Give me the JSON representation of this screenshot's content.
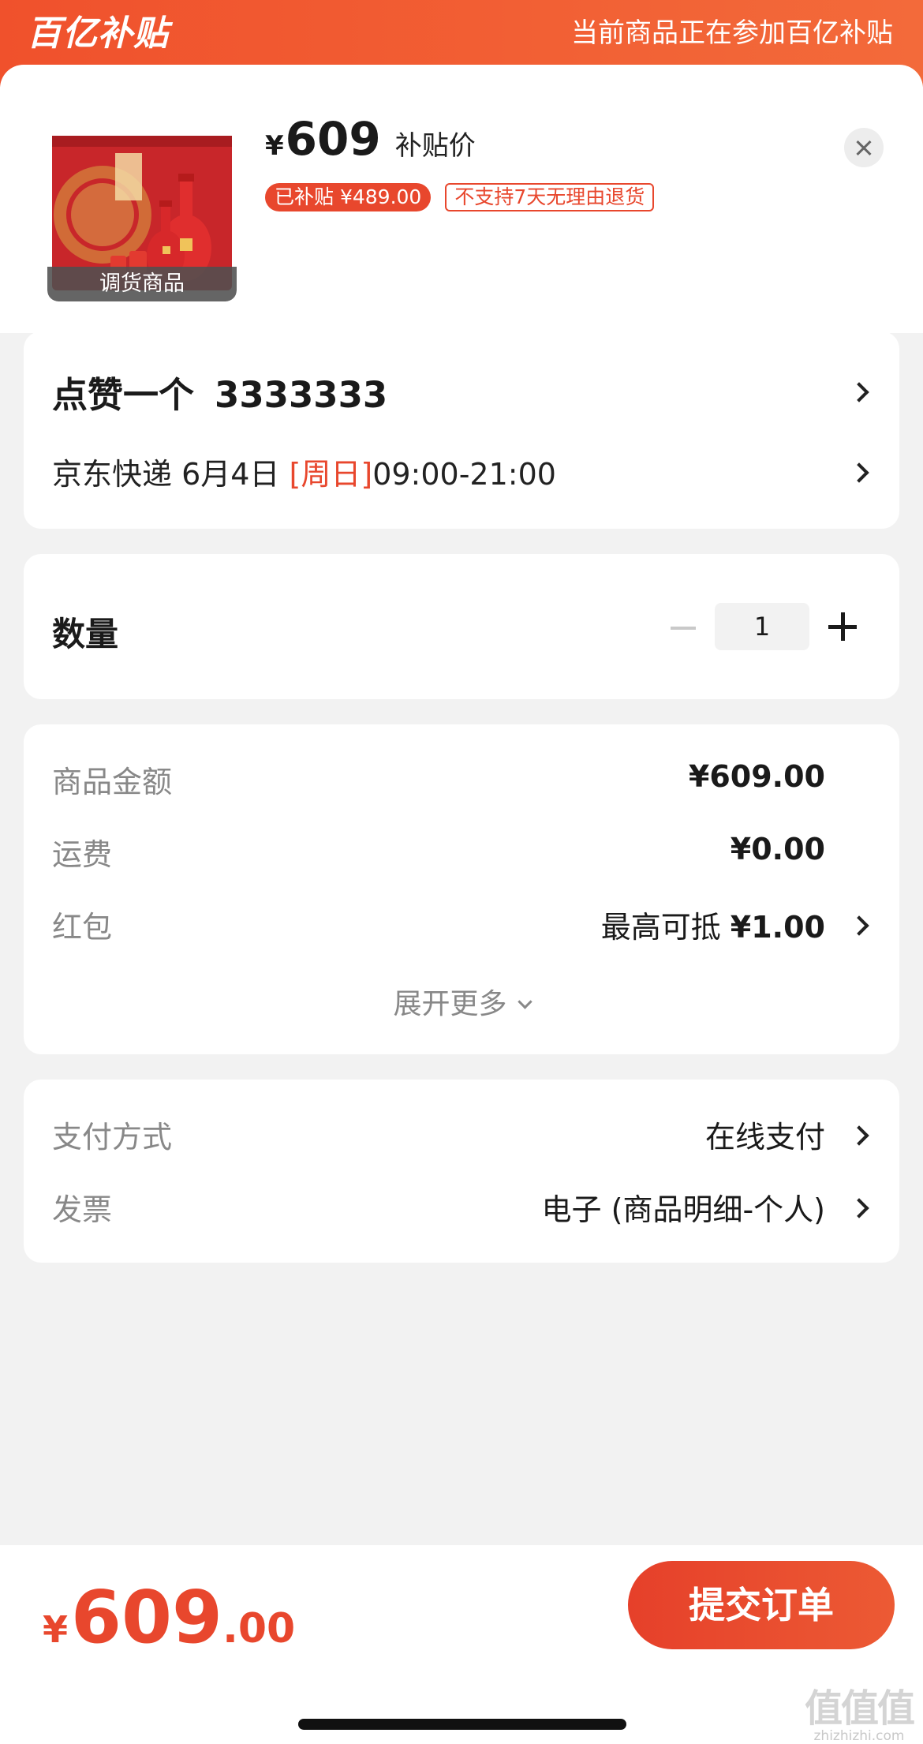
{
  "banner": {
    "logo": "百亿补贴",
    "note": "当前商品正在参加百亿补贴"
  },
  "product": {
    "price_yen": "¥",
    "price": "609",
    "price_tag": "补贴价",
    "subsidy_tag": "已补贴 ¥489.00",
    "return_tag": "不支持7天无理由退货",
    "thumb_caption": "调货商品"
  },
  "address": {
    "name": "点赞一个",
    "phone": "3333333",
    "delivery_prefix": "京东快递 6月4日",
    "delivery_day": "[周日]",
    "delivery_time": "09:00-21:00"
  },
  "quantity": {
    "label": "数量",
    "value": "1"
  },
  "costs": {
    "goods_label": "商品金额",
    "goods_value": "¥609.00",
    "shipping_label": "运费",
    "shipping_value": "¥0.00",
    "redpacket_label": "红包",
    "redpacket_prefix": "最高可抵 ",
    "redpacket_value": "¥1.00",
    "expand_label": "展开更多"
  },
  "payment": {
    "method_label": "支付方式",
    "method_value": "在线支付",
    "invoice_label": "发票",
    "invoice_value": "电子 (商品明细-个人)"
  },
  "footer": {
    "total_yen": "¥",
    "total_int": "609",
    "total_dec": ".00",
    "submit_label": "提交订单"
  },
  "watermark": {
    "main": "值值值",
    "sub": "zhizhizhi.com"
  },
  "colors": {
    "accent": "#e8472d",
    "banner": "#f0512c",
    "background": "#f2f2f2"
  }
}
